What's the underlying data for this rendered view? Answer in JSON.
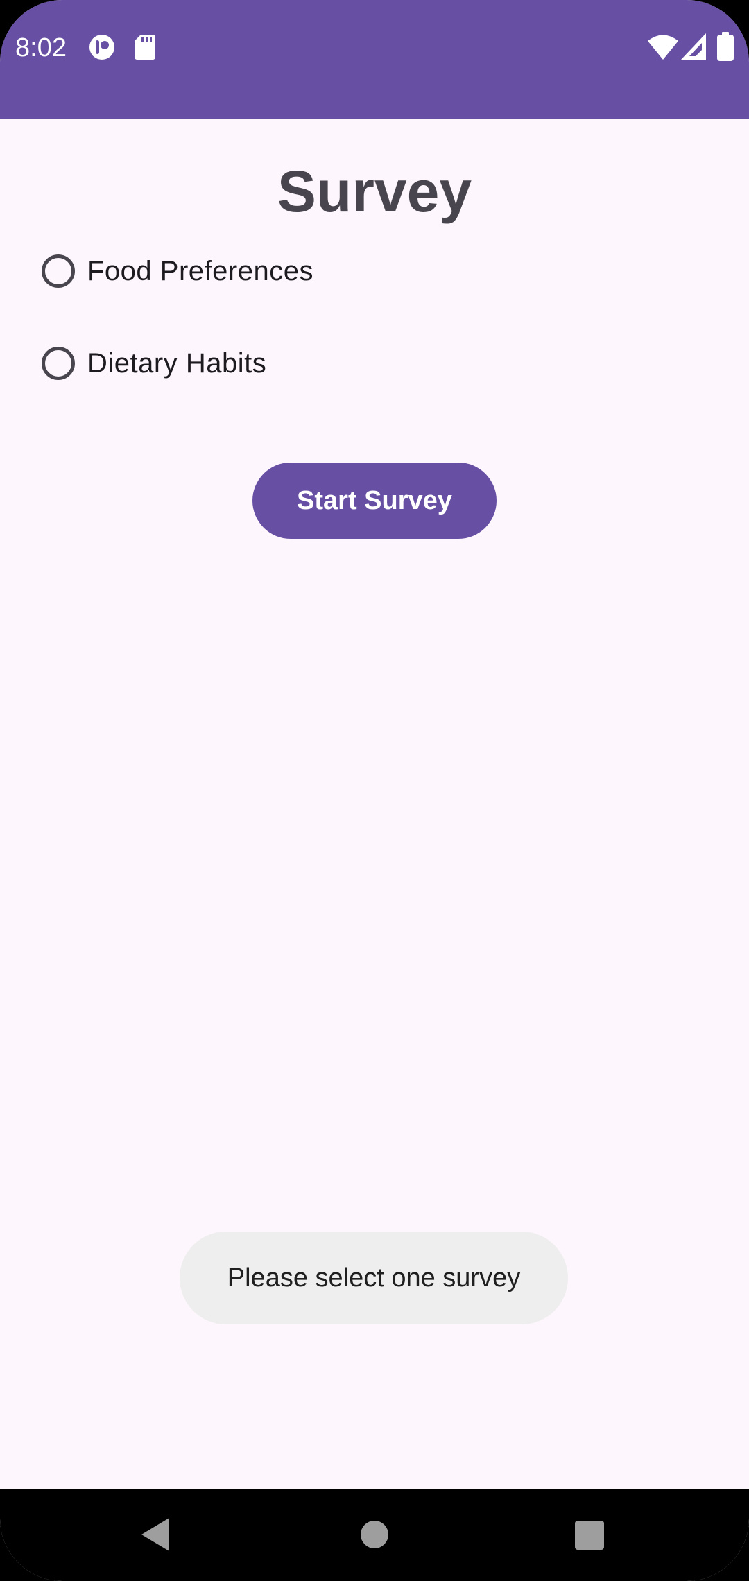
{
  "status_bar": {
    "time": "8:02",
    "icons_left": [
      "pocket-casts-icon",
      "sd-card-icon"
    ],
    "icons_right": [
      "wifi-icon",
      "cellular-signal-icon",
      "battery-icon"
    ],
    "background_color": "#6750a4"
  },
  "survey": {
    "title": "Survey",
    "options": [
      {
        "label": "Food Preferences",
        "selected": false
      },
      {
        "label": "Dietary Habits",
        "selected": false
      }
    ],
    "start_button_label": "Start Survey"
  },
  "toast": {
    "message": "Please select one survey"
  },
  "navigation": {
    "buttons": [
      "back-icon",
      "home-icon",
      "recents-icon"
    ]
  },
  "colors": {
    "accent": "#6750a4",
    "background": "#fdf6fc",
    "title_text": "#49454f",
    "toast_background": "#eeeeee"
  }
}
